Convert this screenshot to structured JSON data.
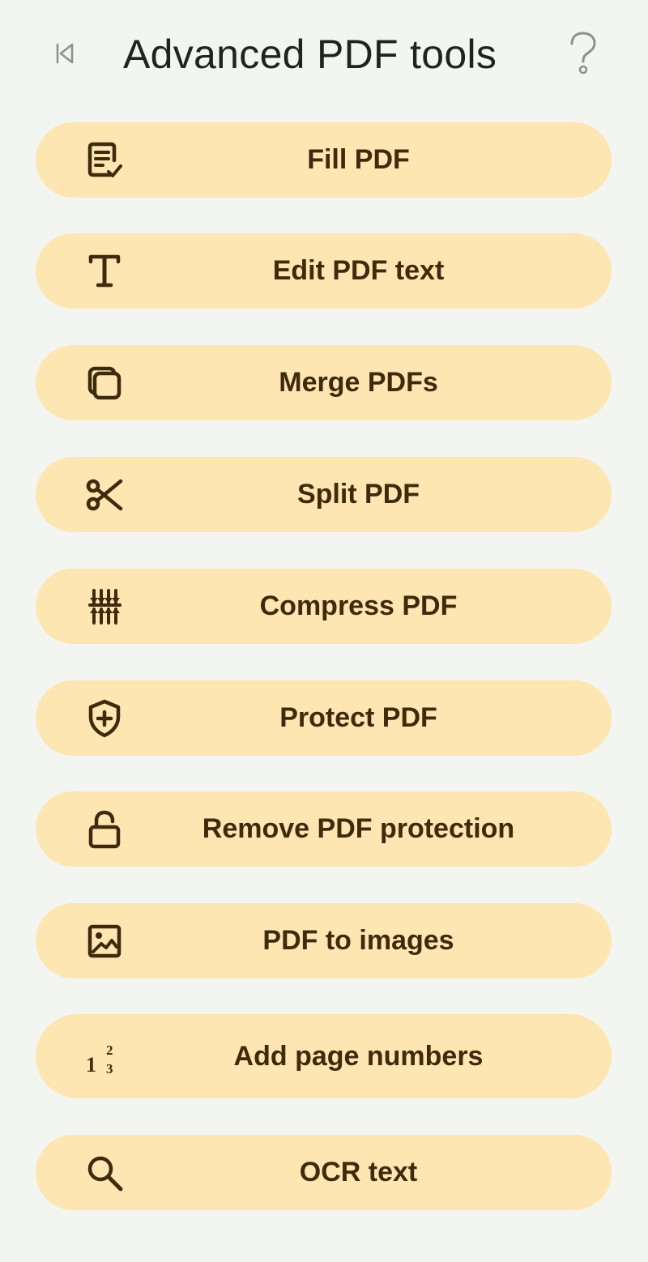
{
  "header": {
    "title": "Advanced PDF tools",
    "back_icon": "skip-previous-icon",
    "help_icon": "question-mark-icon"
  },
  "colors": {
    "background": "#F3F5F0",
    "button_fill": "#FDE6B1",
    "button_text": "#3E2A0C",
    "title_text": "#1F241F",
    "header_icon": "#8A938D"
  },
  "tools": [
    {
      "label": "Fill PDF",
      "icon": "form-checklist-icon"
    },
    {
      "label": "Edit PDF text",
      "icon": "text-cursor-icon"
    },
    {
      "label": "Merge PDFs",
      "icon": "stacked-pages-icon"
    },
    {
      "label": "Split PDF",
      "icon": "scissors-icon"
    },
    {
      "label": "Compress PDF",
      "icon": "compress-arrows-icon"
    },
    {
      "label": "Protect PDF",
      "icon": "shield-plus-icon"
    },
    {
      "label": "Remove PDF protection",
      "icon": "unlocked-padlock-icon"
    },
    {
      "label": "PDF to images",
      "icon": "image-icon"
    },
    {
      "label": "Add page numbers",
      "icon": "page-numbers-icon",
      "icon_digits": [
        "1",
        "2",
        "3"
      ]
    },
    {
      "label": "OCR text",
      "icon": "magnifier-icon"
    }
  ]
}
